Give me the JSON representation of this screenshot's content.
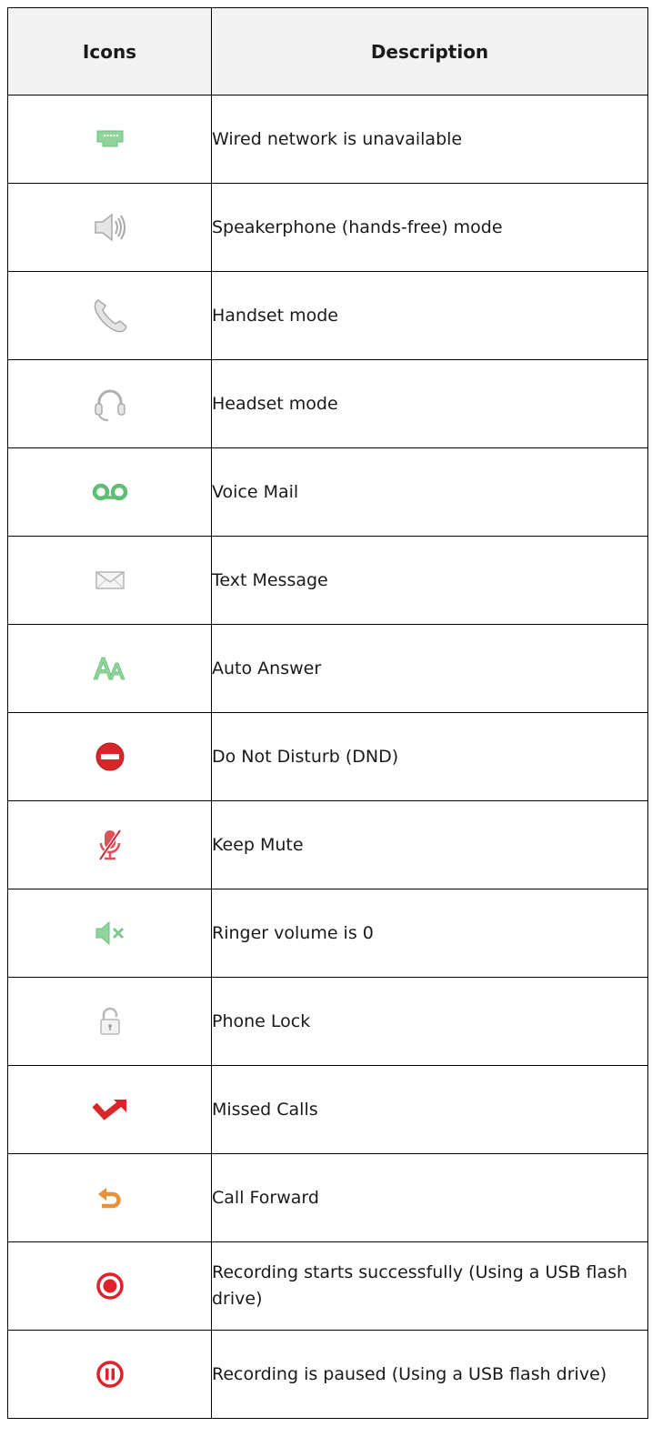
{
  "table": {
    "headers": {
      "icons": "Icons",
      "description": "Description"
    },
    "rows": [
      {
        "icon": "wired-network-unavailable-icon",
        "description": "Wired network is unavailable"
      },
      {
        "icon": "speakerphone-icon",
        "description": "Speakerphone (hands-free) mode"
      },
      {
        "icon": "handset-icon",
        "description": "Handset mode"
      },
      {
        "icon": "headset-icon",
        "description": "Headset mode"
      },
      {
        "icon": "voice-mail-icon",
        "description": "Voice Mail"
      },
      {
        "icon": "text-message-icon",
        "description": "Text Message"
      },
      {
        "icon": "auto-answer-icon",
        "description": "Auto Answer"
      },
      {
        "icon": "do-not-disturb-icon",
        "description": "Do Not Disturb (DND)"
      },
      {
        "icon": "keep-mute-icon",
        "description": "Keep Mute"
      },
      {
        "icon": "ringer-volume-zero-icon",
        "description": "Ringer volume is 0"
      },
      {
        "icon": "phone-lock-icon",
        "description": "Phone Lock"
      },
      {
        "icon": "missed-calls-icon",
        "description": "Missed Calls"
      },
      {
        "icon": "call-forward-icon",
        "description": "Call Forward"
      },
      {
        "icon": "recording-started-icon",
        "description": "Recording starts successfully (Using a USB flash drive)"
      },
      {
        "icon": "recording-paused-icon",
        "description": "Recording is paused (Using a USB flash drive)"
      }
    ]
  },
  "colors": {
    "border": "#000000",
    "header_background": "#f2f2f2",
    "network_green": "#8fd49a",
    "voicemail_green": "#5cbf73",
    "icon_gray": "#bdbdbd",
    "dnd_red": "#d9262b",
    "mute_red": "#e0505a",
    "missed_red": "#d9262b",
    "forward_orange": "#e8913a",
    "record_red": "#e0202a"
  }
}
